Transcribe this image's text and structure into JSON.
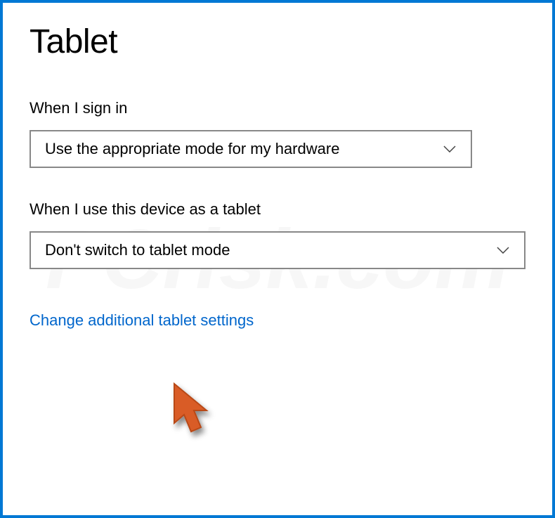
{
  "page": {
    "title": "Tablet"
  },
  "settings": {
    "signin": {
      "label": "When I sign in",
      "value": "Use the appropriate mode for my hardware"
    },
    "tablet_use": {
      "label": "When I use this device as a tablet",
      "value": "Don't switch to tablet mode"
    }
  },
  "link": {
    "change_additional": "Change additional tablet settings"
  },
  "watermark": "PCrisk.com"
}
